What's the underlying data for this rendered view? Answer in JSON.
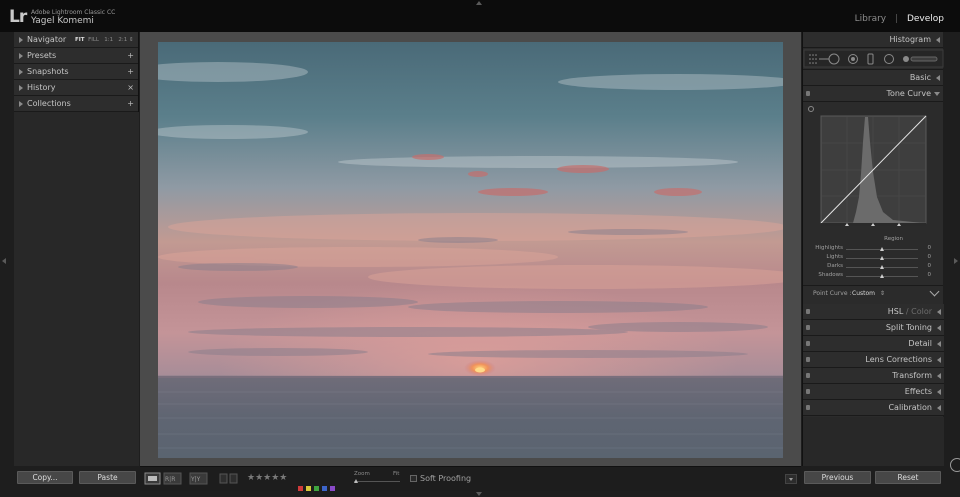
{
  "app": {
    "logo": "Lr",
    "name": "Adobe Lightroom Classic CC",
    "user": "Yagel Komemi"
  },
  "modules": {
    "items": [
      "Library",
      "Develop"
    ],
    "active": "Develop"
  },
  "left_panel": {
    "navigator": {
      "label": "Navigator",
      "options": [
        "FIT",
        "FILL",
        "1:1",
        "2:1"
      ],
      "active_option": "FIT"
    },
    "items": [
      {
        "label": "Presets",
        "action": "+"
      },
      {
        "label": "Snapshots",
        "action": "+"
      },
      {
        "label": "History",
        "action": "×"
      },
      {
        "label": "Collections",
        "action": "+"
      }
    ],
    "copy_button": "Copy...",
    "paste_button": "Paste"
  },
  "right_panel": {
    "histogram": "Histogram",
    "basic": "Basic",
    "tone_curve": {
      "label": "Tone Curve",
      "region_label": "Region",
      "sliders": [
        {
          "label": "Highlights",
          "value": "0"
        },
        {
          "label": "Lights",
          "value": "0"
        },
        {
          "label": "Darks",
          "value": "0"
        },
        {
          "label": "Shadows",
          "value": "0"
        }
      ],
      "point_curve_label": "Point Curve :",
      "point_curve_value": "Custom",
      "point_curve_chevron": "⇕"
    },
    "hsl": {
      "part1": "HSL",
      "sep": " / ",
      "part2": "Color"
    },
    "sections": [
      "Split Toning",
      "Detail",
      "Lens Corrections",
      "Transform",
      "Effects",
      "Calibration"
    ],
    "previous_button": "Previous",
    "reset_button": "Reset"
  },
  "toolbar": {
    "stars": "★★★★★",
    "color_labels": [
      "#d03a3a",
      "#d8c83a",
      "#3fa53f",
      "#3c64c8",
      "#8a4ac8"
    ],
    "zoom_label": "Zoom",
    "zoom_fit": "Fit",
    "soft_proofing": "Soft Proofing"
  }
}
